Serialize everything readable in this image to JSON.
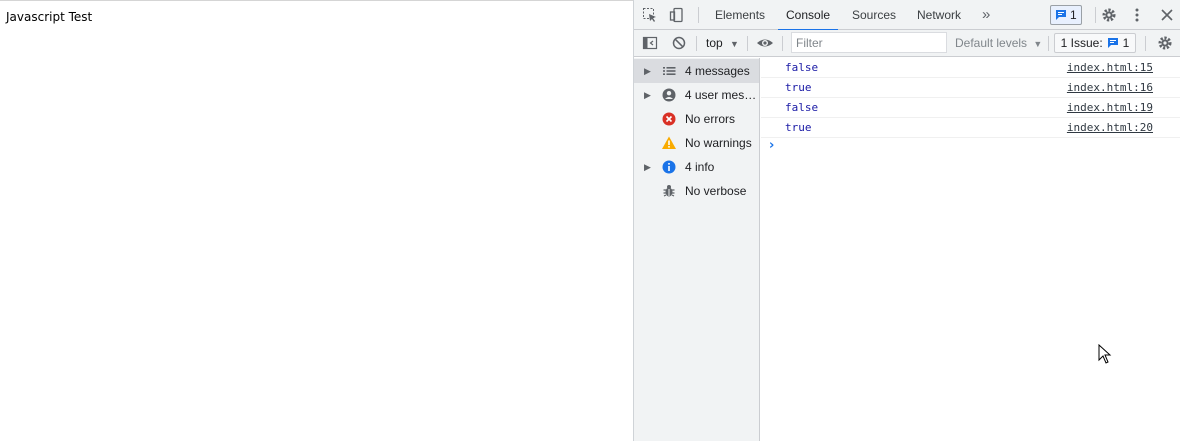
{
  "page": {
    "text": "Javascript Test"
  },
  "devtools": {
    "tabs": [
      {
        "label": "Elements",
        "active": false
      },
      {
        "label": "Console",
        "active": true
      },
      {
        "label": "Sources",
        "active": false
      },
      {
        "label": "Network",
        "active": false
      }
    ],
    "more_tabs_label": "»",
    "issues_badge_count": "1",
    "icons": [
      "inspect-element-icon",
      "device-toolbar-icon",
      "settings-icon",
      "more-vert-icon",
      "close-icon"
    ]
  },
  "toolbar": {
    "context": "top",
    "filter_placeholder": "Filter",
    "levels_label": "Default levels",
    "issues_label": "1 Issue:",
    "issues_count": "1"
  },
  "sidebar": {
    "items": [
      {
        "label": "4 messages",
        "expandable": true,
        "selected": true,
        "icon": "list-icon"
      },
      {
        "label": "4 user mess...",
        "expandable": true,
        "selected": false,
        "icon": "user-icon"
      },
      {
        "label": "No errors",
        "expandable": false,
        "selected": false,
        "icon": "error-icon"
      },
      {
        "label": "No warnings",
        "expandable": false,
        "selected": false,
        "icon": "warning-icon"
      },
      {
        "label": "4 info",
        "expandable": true,
        "selected": false,
        "icon": "info-icon"
      },
      {
        "label": "No verbose",
        "expandable": false,
        "selected": false,
        "icon": "bug-icon"
      }
    ]
  },
  "console": {
    "messages": [
      {
        "text": "false",
        "source": "index.html:15"
      },
      {
        "text": "true",
        "source": "index.html:16"
      },
      {
        "text": "false",
        "source": "index.html:19"
      },
      {
        "text": "true",
        "source": "index.html:20"
      }
    ],
    "prompt": "›"
  },
  "colors": {
    "accent": "#1a73e8",
    "error": "#d93025",
    "warning": "#f9ab00",
    "info": "#1a73e8"
  }
}
